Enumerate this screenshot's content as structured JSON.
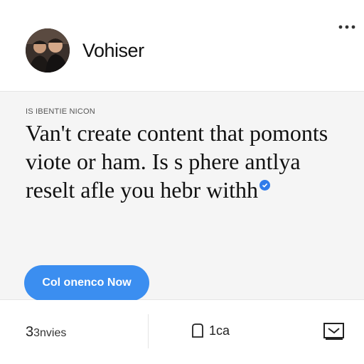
{
  "header": {
    "username": "Vohiser",
    "more_icon": "more-horizontal-icon"
  },
  "body": {
    "category": "IS IBENTIE NICON",
    "message": "Van't create content that pomonts viote or ham. Is s phere antlya reselt afle you hebr with",
    "message_end": "h",
    "cta_label": "Col onenco Now"
  },
  "footer": {
    "reactions_count": "3",
    "reactions_label": "3nvies",
    "comments_count": "1ca",
    "comment_icon": "comment-icon",
    "share_icon": "share-icon"
  },
  "colors": {
    "accent": "#3b8ef0",
    "verified": "#2f7bea",
    "body_background": "#f5f5f5"
  }
}
